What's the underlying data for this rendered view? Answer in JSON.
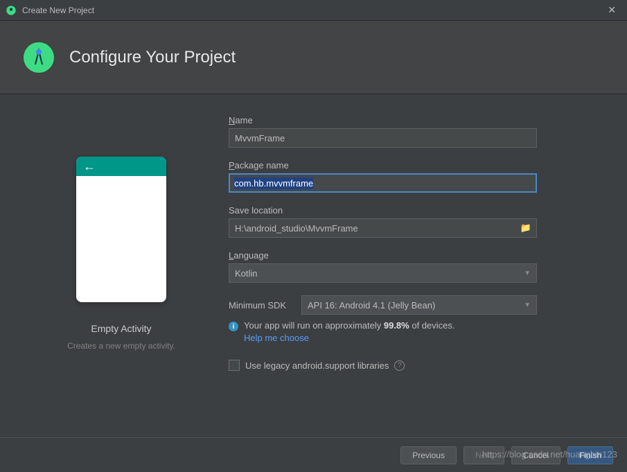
{
  "window": {
    "title": "Create New Project"
  },
  "header": {
    "title": "Configure Your Project"
  },
  "preview": {
    "title": "Empty Activity",
    "description": "Creates a new empty activity."
  },
  "form": {
    "name_label_prefix": "N",
    "name_label_rest": "ame",
    "name_value": "MvvmFrame",
    "package_label_prefix": "P",
    "package_label_rest": "ackage name",
    "package_value": "com.hb.mvvmframe",
    "save_label": "Save location",
    "save_value": "H:\\android_studio\\MvvmFrame",
    "language_label_prefix": "L",
    "language_label_rest": "anguage",
    "language_value": "Kotlin",
    "min_sdk_label": "Minimum SDK",
    "min_sdk_value": "API 16: Android 4.1 (Jelly Bean)",
    "info_text_prefix": "Your app will run on approximately ",
    "info_percent": "99.8%",
    "info_text_suffix": " of devices.",
    "help_link": "Help me choose",
    "legacy_label": "Use legacy android.support libraries"
  },
  "footer": {
    "previous": "Previous",
    "next": "Next",
    "cancel": "Cancel",
    "finish": "Finish"
  },
  "watermark": "https://blog.csdn.net/huangbin123"
}
